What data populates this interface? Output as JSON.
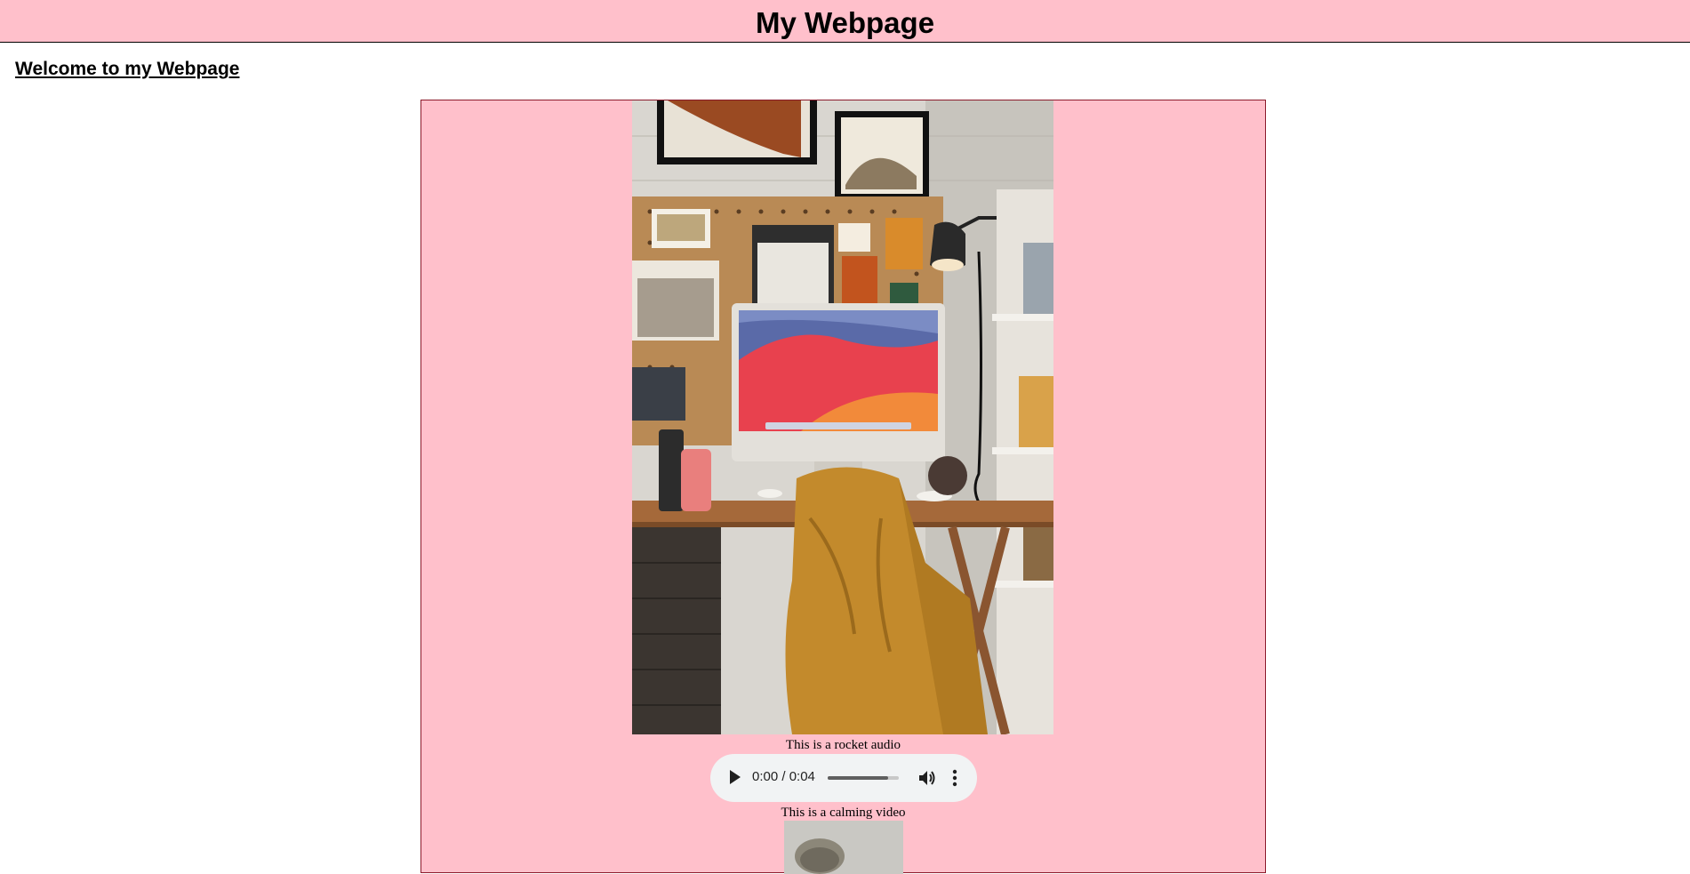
{
  "header": {
    "title": "My Webpage"
  },
  "welcome": {
    "text": "Welcome to my Webpage"
  },
  "media": {
    "image_alt": "desk setup with computer and chair",
    "audio_caption": "This is a rocket audio",
    "audio_player": {
      "time_display": "0:00 / 0:04",
      "progress_fraction": 0,
      "volume_fraction": 0.85
    },
    "video_caption": "This is a calming video"
  },
  "colors": {
    "header_bg": "#ffc0cb",
    "box_bg": "#ffc0cb",
    "box_border": "#8b1a2b"
  }
}
